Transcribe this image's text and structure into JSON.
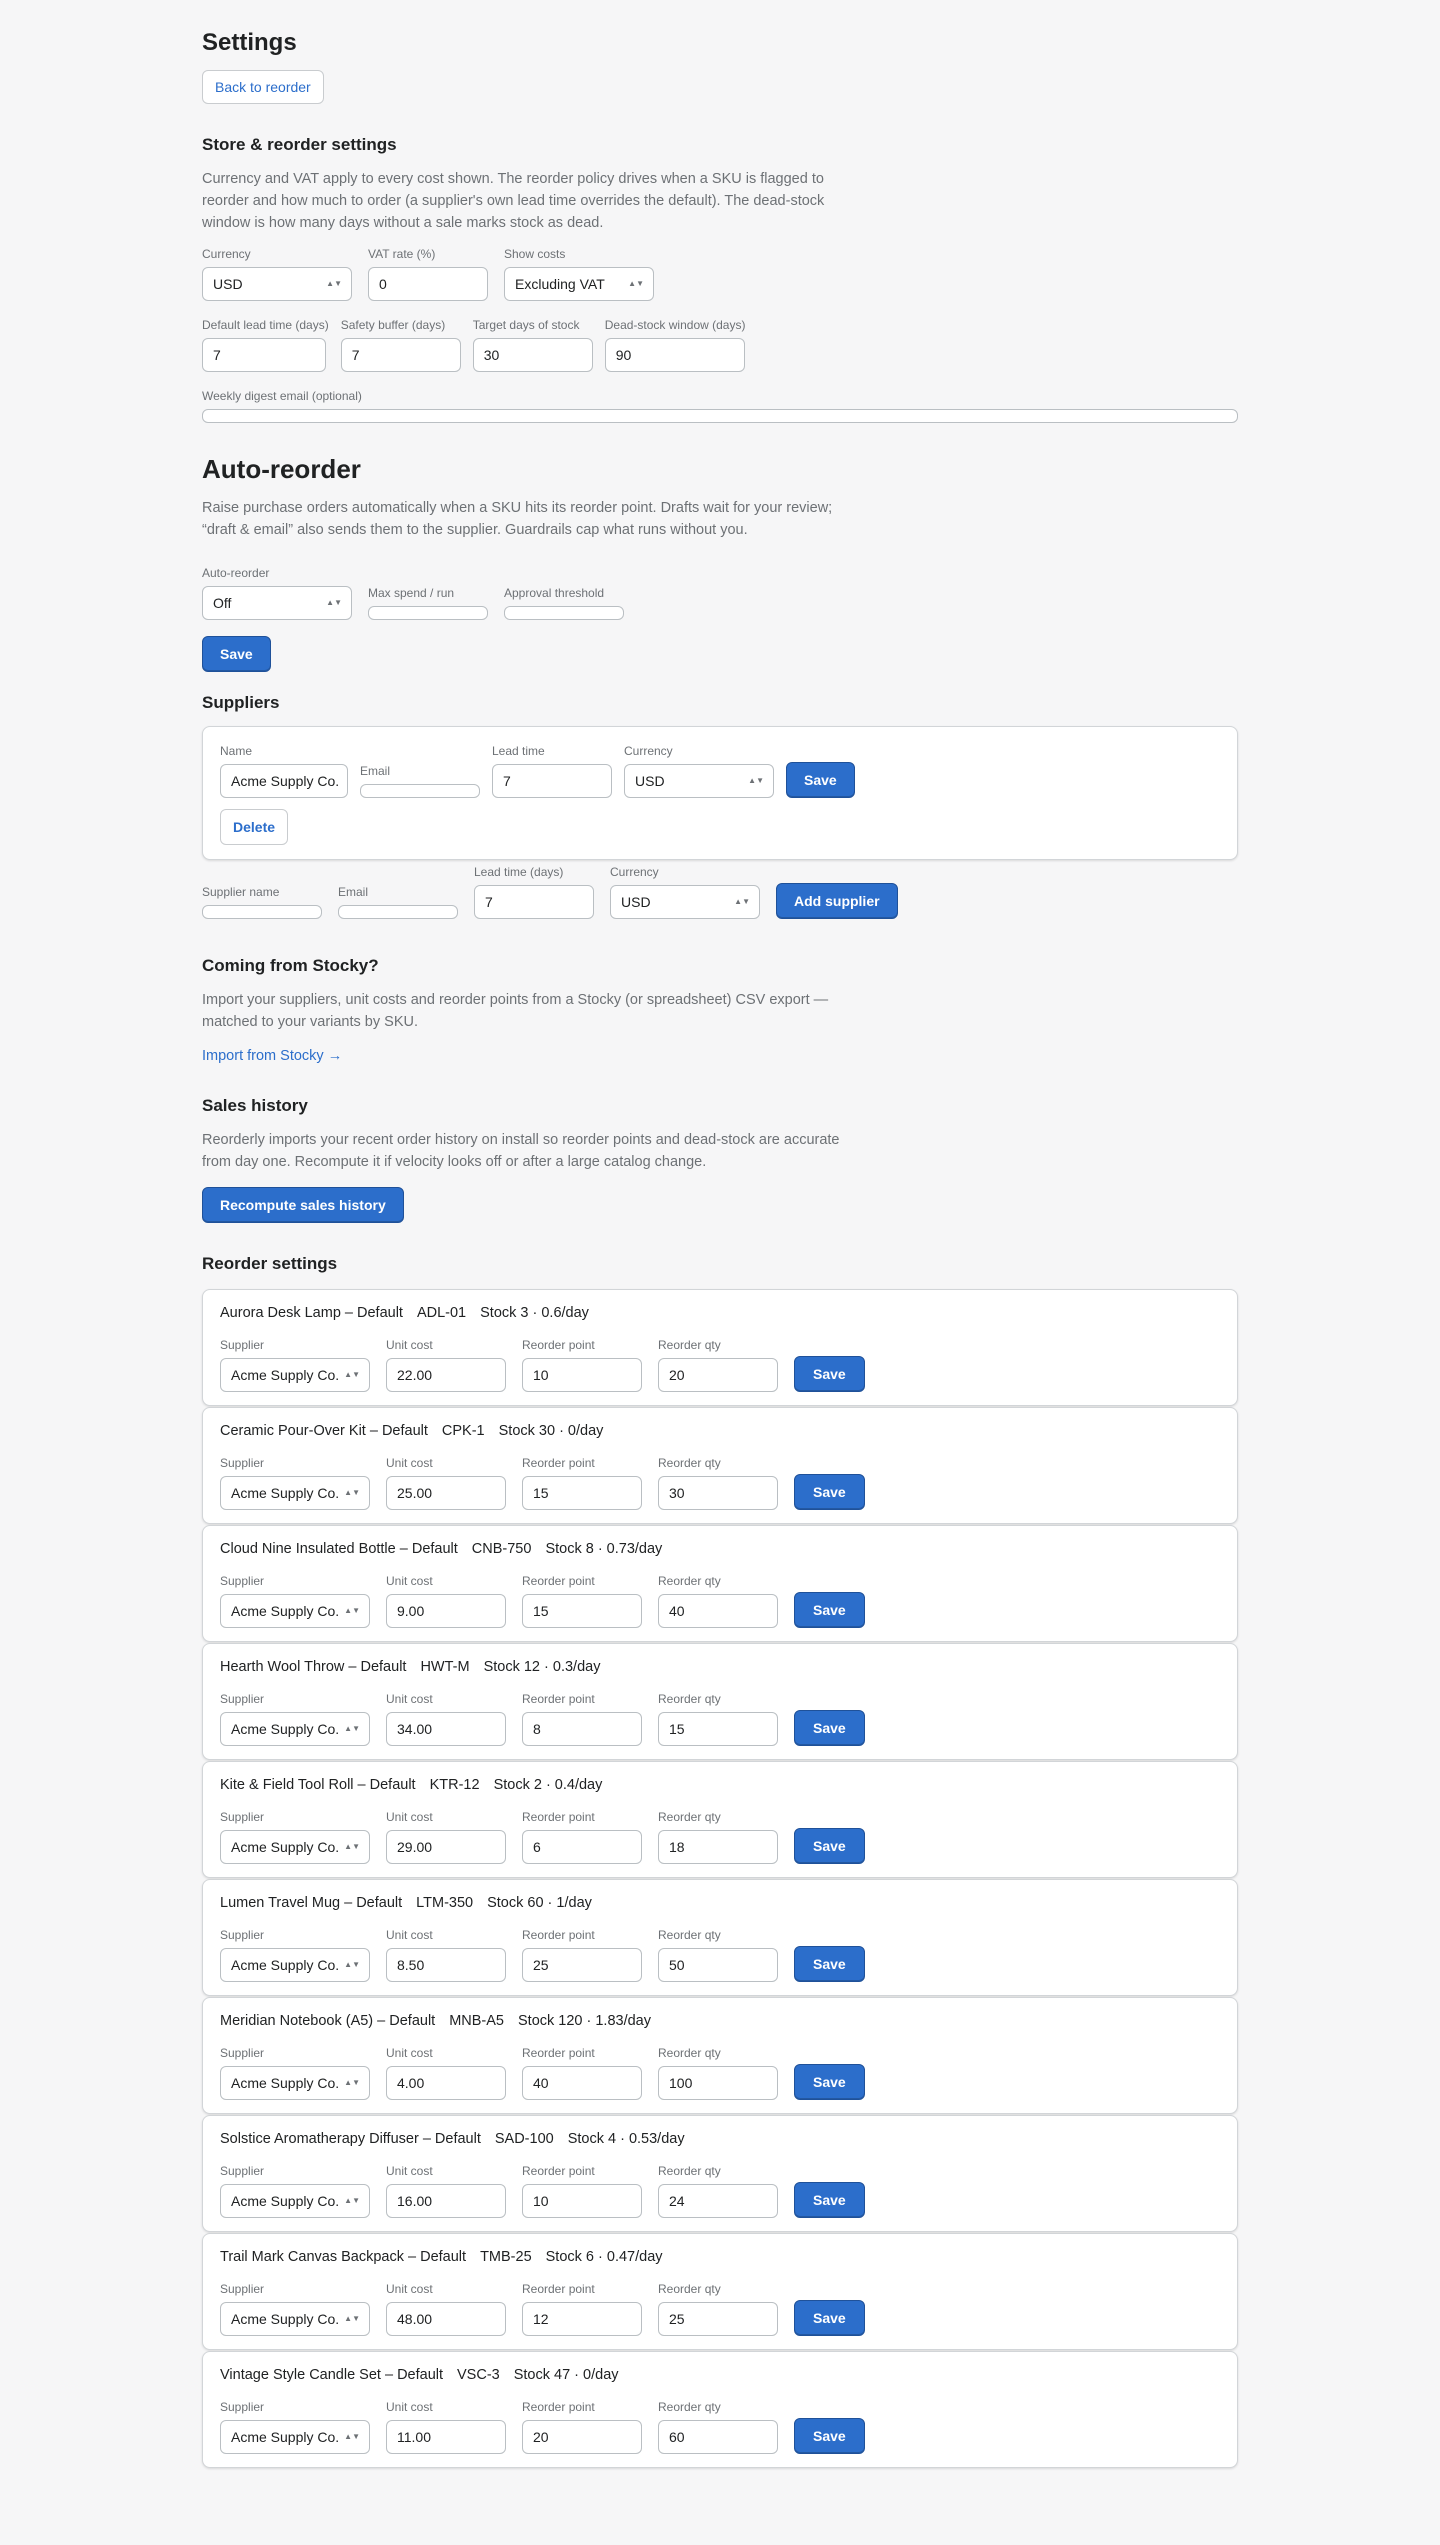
{
  "page": {
    "title": "Settings",
    "back_button": "Back to reorder"
  },
  "store": {
    "heading": "Store & reorder settings",
    "description": "Currency and VAT apply to every cost shown. The reorder policy drives when a SKU is flagged to reorder and how much to order (a supplier's own lead time overrides the default). The dead-stock window is how many days without a sale marks stock as dead.",
    "currency_label": "Currency",
    "currency_value": "USD",
    "vat_label": "VAT rate (%)",
    "vat_value": "0",
    "costs_label": "Show costs",
    "costs_value": "Excluding VAT",
    "lead_label": "Default lead time (days)",
    "lead_value": "7",
    "buffer_label": "Safety buffer (days)",
    "buffer_value": "7",
    "target_label": "Target days of stock",
    "target_value": "30",
    "dead_label": "Dead-stock window (days)",
    "dead_value": "90",
    "email_label": "Weekly digest email (optional)",
    "email_value": ""
  },
  "auto": {
    "heading": "Auto-reorder",
    "description": "Raise purchase orders automatically when a SKU hits its reorder point. Drafts wait for your review; “draft & email” also sends them to the supplier. Guardrails cap what runs without you.",
    "mode_label": "Auto-reorder",
    "mode_value": "Off",
    "spend_label": "Max spend / run",
    "spend_value": "",
    "approval_label": "Approval threshold",
    "approval_value": "",
    "save_label": "Save"
  },
  "suppliers": {
    "heading": "Suppliers",
    "existing": {
      "name_label": "Name",
      "name_value": "Acme Supply Co.",
      "email_label": "Email",
      "email_value": "",
      "lead_label": "Lead time",
      "lead_value": "7",
      "currency_label": "Currency",
      "currency_value": "USD",
      "save_label": "Save",
      "delete_label": "Delete"
    },
    "new": {
      "name_label": "Supplier name",
      "name_value": "",
      "email_label": "Email",
      "email_value": "",
      "lead_label": "Lead time (days)",
      "lead_value": "7",
      "currency_label": "Currency",
      "currency_value": "USD",
      "add_label": "Add supplier"
    }
  },
  "stocky": {
    "heading": "Coming from Stocky?",
    "description": "Import your suppliers, unit costs and reorder points from a Stocky (or spreadsheet) CSV export — matched to your variants by SKU.",
    "link": "Import from Stocky →"
  },
  "sales": {
    "heading": "Sales history",
    "description": "Reorderly imports your recent order history on install so reorder points and dead-stock are accurate from day one. Recompute it if velocity looks off or after a large catalog change.",
    "button": "Recompute sales history"
  },
  "reorder": {
    "heading": "Reorder settings",
    "labels": {
      "supplier": "Supplier",
      "unit_cost": "Unit cost",
      "reorder_point": "Reorder point",
      "reorder_qty": "Reorder qty",
      "save": "Save"
    },
    "rows": [
      {
        "name": "Aurora Desk Lamp – Default",
        "sku": "ADL-01",
        "stock": "Stock 3 · 0.6/day",
        "supplier": "Acme Supply Co.",
        "unit_cost": "22.00",
        "reorder_point": "10",
        "reorder_qty": "20"
      },
      {
        "name": "Ceramic Pour-Over Kit – Default",
        "sku": "CPK-1",
        "stock": "Stock 30 · 0/day",
        "supplier": "Acme Supply Co.",
        "unit_cost": "25.00",
        "reorder_point": "15",
        "reorder_qty": "30"
      },
      {
        "name": "Cloud Nine Insulated Bottle – Default",
        "sku": "CNB-750",
        "stock": "Stock 8 · 0.73/day",
        "supplier": "Acme Supply Co.",
        "unit_cost": "9.00",
        "reorder_point": "15",
        "reorder_qty": "40"
      },
      {
        "name": "Hearth Wool Throw – Default",
        "sku": "HWT-M",
        "stock": "Stock 12 · 0.3/day",
        "supplier": "Acme Supply Co.",
        "unit_cost": "34.00",
        "reorder_point": "8",
        "reorder_qty": "15"
      },
      {
        "name": "Kite & Field Tool Roll – Default",
        "sku": "KTR-12",
        "stock": "Stock 2 · 0.4/day",
        "supplier": "Acme Supply Co.",
        "unit_cost": "29.00",
        "reorder_point": "6",
        "reorder_qty": "18"
      },
      {
        "name": "Lumen Travel Mug – Default",
        "sku": "LTM-350",
        "stock": "Stock 60 · 1/day",
        "supplier": "Acme Supply Co.",
        "unit_cost": "8.50",
        "reorder_point": "25",
        "reorder_qty": "50"
      },
      {
        "name": "Meridian Notebook (A5) – Default",
        "sku": "MNB-A5",
        "stock": "Stock 120 · 1.83/day",
        "supplier": "Acme Supply Co.",
        "unit_cost": "4.00",
        "reorder_point": "40",
        "reorder_qty": "100"
      },
      {
        "name": "Solstice Aromatherapy Diffuser – Default",
        "sku": "SAD-100",
        "stock": "Stock 4 · 0.53/day",
        "supplier": "Acme Supply Co.",
        "unit_cost": "16.00",
        "reorder_point": "10",
        "reorder_qty": "24"
      },
      {
        "name": "Trail Mark Canvas Backpack – Default",
        "sku": "TMB-25",
        "stock": "Stock 6 · 0.47/day",
        "supplier": "Acme Supply Co.",
        "unit_cost": "48.00",
        "reorder_point": "12",
        "reorder_qty": "25"
      },
      {
        "name": "Vintage Style Candle Set – Default",
        "sku": "VSC-3",
        "stock": "Stock 47 · 0/day",
        "supplier": "Acme Supply Co.",
        "unit_cost": "11.00",
        "reorder_point": "20",
        "reorder_qty": "60"
      }
    ]
  },
  "colors": {
    "primary": "#2c6ecb",
    "background": "#f6f6f7",
    "text": "#202223",
    "muted": "#6d7175"
  }
}
